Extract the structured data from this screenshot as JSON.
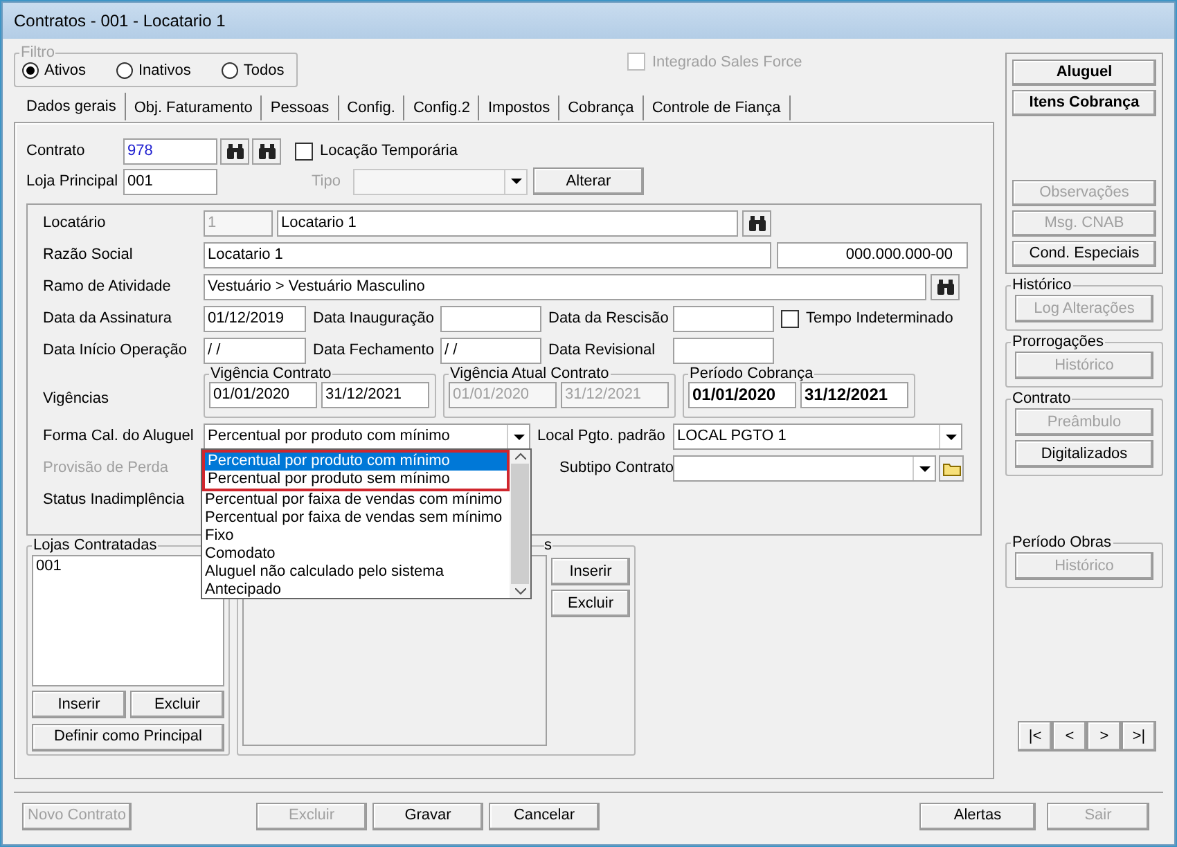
{
  "window": {
    "title": "Contratos - 001 - Locatario 1"
  },
  "filter": {
    "title": "Filtro",
    "options": [
      {
        "label": "Ativos",
        "selected": true
      },
      {
        "label": "Inativos",
        "selected": false
      },
      {
        "label": "Todos",
        "selected": false
      }
    ]
  },
  "integrado": {
    "label": "Integrado Sales Force",
    "checked": false,
    "disabled": true
  },
  "tabs": [
    {
      "label": "Dados gerais",
      "selected": true
    },
    {
      "label": "Obj. Faturamento",
      "selected": false
    },
    {
      "label": "Pessoas",
      "selected": false
    },
    {
      "label": "Config.",
      "selected": false
    },
    {
      "label": "Config.2",
      "selected": false
    },
    {
      "label": "Impostos",
      "selected": false
    },
    {
      "label": "Cobrança",
      "selected": false
    },
    {
      "label": "Controle de Fiança",
      "selected": false
    }
  ],
  "contrato": {
    "label": "Contrato",
    "value": "978"
  },
  "locacao_temporaria": {
    "label": "Locação Temporária",
    "checked": false
  },
  "loja_principal": {
    "label": "Loja Principal",
    "value": "001"
  },
  "tipo": {
    "label": "Tipo",
    "disabled": true
  },
  "alterar_button": "Alterar",
  "locatario": {
    "label": "Locatário",
    "code": "1",
    "name": "Locatario 1"
  },
  "razao_social": {
    "label": "Razão Social",
    "value": "Locatario 1",
    "document": "000.000.000-00"
  },
  "ramo": {
    "label": "Ramo de Atividade",
    "value": "Vestuário > Vestuário Masculino"
  },
  "date_rows": [
    [
      {
        "label": "Data da Assinatura",
        "value": "01/12/2019"
      },
      {
        "label": "Data Inauguração"
      },
      {
        "label": "Data da Rescisão"
      }
    ],
    [
      {
        "label": "Data Início Operação",
        "value": " / /"
      },
      {
        "label": "Data Fechamento",
        "value": " / /"
      },
      {
        "label": "Data Revisional"
      }
    ]
  ],
  "tempo_indeterminado": {
    "label": "Tempo Indeterminado",
    "checked": false
  },
  "vigencias": {
    "label": "Vigências",
    "groups": [
      {
        "title": "Vigência Contrato",
        "start": "01/01/2020",
        "end": "31/12/2021",
        "kind": "normal"
      },
      {
        "title": "Vigência Atual Contrato",
        "start": "01/01/2020",
        "end": "31/12/2021",
        "kind": "disabled"
      },
      {
        "title": "Período Cobrança",
        "start": "01/01/2020",
        "end": "31/12/2021",
        "kind": "bold"
      }
    ]
  },
  "forma_cal": {
    "label": "Forma Cal. do Aluguel",
    "value": "Percentual por produto com mínimo",
    "options": [
      {
        "label": "Percentual por produto com mínimo",
        "selected": true,
        "highlighted": true
      },
      {
        "label": "Percentual por produto sem mínimo",
        "selected": false,
        "highlighted": true
      },
      {
        "label": "Percentual por faixa de vendas com mínimo",
        "selected": false,
        "highlighted": false
      },
      {
        "label": "Percentual por faixa de vendas sem mínimo",
        "selected": false,
        "highlighted": false
      },
      {
        "label": "Fixo",
        "selected": false,
        "highlighted": false
      },
      {
        "label": "Comodato",
        "selected": false,
        "highlighted": false
      },
      {
        "label": "Aluguel não calculado pelo sistema",
        "selected": false,
        "highlighted": false
      },
      {
        "label": "Antecipado",
        "selected": false,
        "highlighted": false
      }
    ]
  },
  "local_pgto": {
    "label": "Local Pgto. padrão",
    "value": "LOCAL PGTO 1"
  },
  "provisao": {
    "label": "Provisão de Perda",
    "disabled": true
  },
  "subtipo": {
    "label": "Subtipo Contrato"
  },
  "status": {
    "label": "Status Inadimplência"
  },
  "lojas": {
    "title": "Lojas Contratadas",
    "items": [
      "001"
    ],
    "buttons": [
      "Inserir",
      "Excluir"
    ],
    "principal_button": "Definir como Principal"
  },
  "group_2": {
    "title": "s",
    "buttons": [
      "Inserir",
      "Excluir"
    ]
  },
  "side_buttons": [
    {
      "label": "Aluguel",
      "disabled": false,
      "bold": true
    },
    {
      "label": "Itens Cobrança",
      "disabled": false,
      "bold": true
    },
    {
      "label": "Observações",
      "disabled": true,
      "bold": false
    },
    {
      "label": "Msg. CNAB",
      "disabled": true,
      "bold": false
    },
    {
      "label": "Cond. Especiais",
      "disabled": false,
      "bold": false
    }
  ],
  "side_groups": [
    {
      "title": "Histórico",
      "buttons": [
        {
          "label": "Log Alterações",
          "disabled": true
        }
      ]
    },
    {
      "title": "Prorrogações",
      "buttons": [
        {
          "label": "Histórico",
          "disabled": true
        }
      ]
    },
    {
      "title": "Contrato",
      "buttons": [
        {
          "label": "Preâmbulo",
          "disabled": true
        },
        {
          "label": "Digitalizados",
          "disabled": false
        }
      ]
    }
  ],
  "periodo_obras": {
    "title": "Período Obras",
    "buttons": [
      {
        "label": "Histórico",
        "disabled": true
      }
    ]
  },
  "nav_buttons": [
    "|<",
    "<",
    ">",
    ">|"
  ],
  "footer_buttons": [
    {
      "label": "Novo Contrato",
      "disabled": true
    },
    {
      "label": "Excluir",
      "disabled": true
    },
    {
      "label": "Gravar",
      "disabled": false
    },
    {
      "label": "Cancelar",
      "disabled": false
    },
    {
      "label": "Alertas",
      "disabled": false
    },
    {
      "label": "Sair",
      "disabled": true
    }
  ]
}
